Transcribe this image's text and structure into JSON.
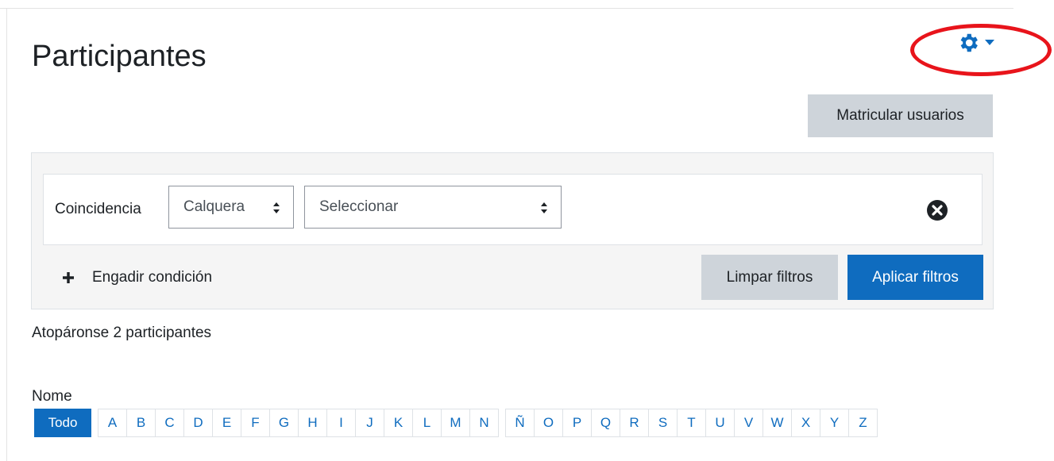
{
  "page": {
    "title": "Participantes"
  },
  "actions": {
    "settings_icon": "gear-icon",
    "enrol_label": "Matricular usuarios"
  },
  "filters": {
    "match_label": "Coincidencia",
    "match_value": "Calquera",
    "type_value": "Seleccionar",
    "add_condition_label": "Engadir condición",
    "clear_label": "Limpar filtros",
    "apply_label": "Aplicar filtros"
  },
  "summary": {
    "found_text": "Atopáronse 2 participantes"
  },
  "initials": {
    "label": "Nome",
    "letters": [
      "Todo",
      "A",
      "B",
      "C",
      "D",
      "E",
      "F",
      "G",
      "H",
      "I",
      "J",
      "K",
      "L",
      "M",
      "N",
      "Ñ",
      "O",
      "P",
      "Q",
      "R",
      "S",
      "T",
      "U",
      "V",
      "W",
      "X",
      "Y",
      "Z"
    ],
    "active": "Todo"
  },
  "colors": {
    "primary": "#0f6cbf",
    "secondary": "#ced4da",
    "highlight": "#e8141b"
  }
}
